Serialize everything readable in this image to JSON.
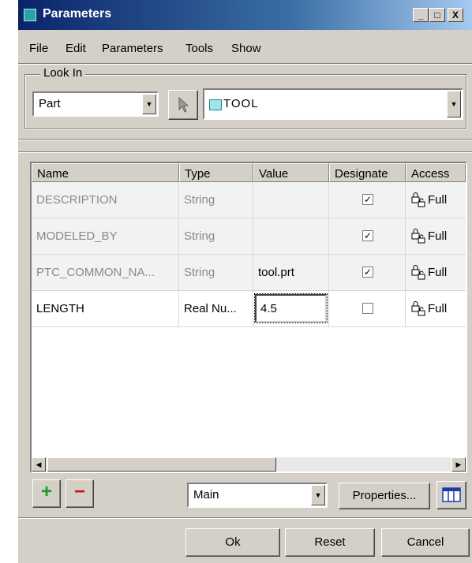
{
  "window": {
    "title": "Parameters",
    "controls": {
      "minimize": "_",
      "maximize": "□",
      "close": "X"
    }
  },
  "menu": [
    "File",
    "Edit",
    "Parameters",
    "Tools",
    "Show"
  ],
  "look_in": {
    "label": "Look In",
    "type_value": "Part",
    "object_value": "TOOL"
  },
  "table": {
    "columns": [
      "Name",
      "Type",
      "Value",
      "Designate",
      "Access"
    ],
    "rows": [
      {
        "name": "DESCRIPTION",
        "type": "String",
        "value": "",
        "designate": "✓",
        "access": "Full"
      },
      {
        "name": "MODELED_BY",
        "type": "String",
        "value": "",
        "designate": "✓",
        "access": "Full"
      },
      {
        "name": "PTC_COMMON_NA...",
        "type": "String",
        "value": "tool.prt",
        "designate": "✓",
        "access": "Full"
      },
      {
        "name": "LENGTH",
        "type": "Real Nu...",
        "value": "4.5",
        "designate": "",
        "access": "Full"
      }
    ]
  },
  "toolbar": {
    "add": "+",
    "remove": "−",
    "filter_value": "Main",
    "properties_label": "Properties..."
  },
  "buttons": {
    "ok": "Ok",
    "reset": "Reset",
    "cancel": "Cancel"
  },
  "colors": {
    "titlebar": "#0a246a",
    "add_icon": "#1a9a1a",
    "remove_icon": "#cc1111",
    "face": "#d4d0c8"
  },
  "icons": {
    "title": "parameters-icon",
    "object": "part-icon",
    "access": "lock-icon",
    "select": "arrow-icon"
  }
}
